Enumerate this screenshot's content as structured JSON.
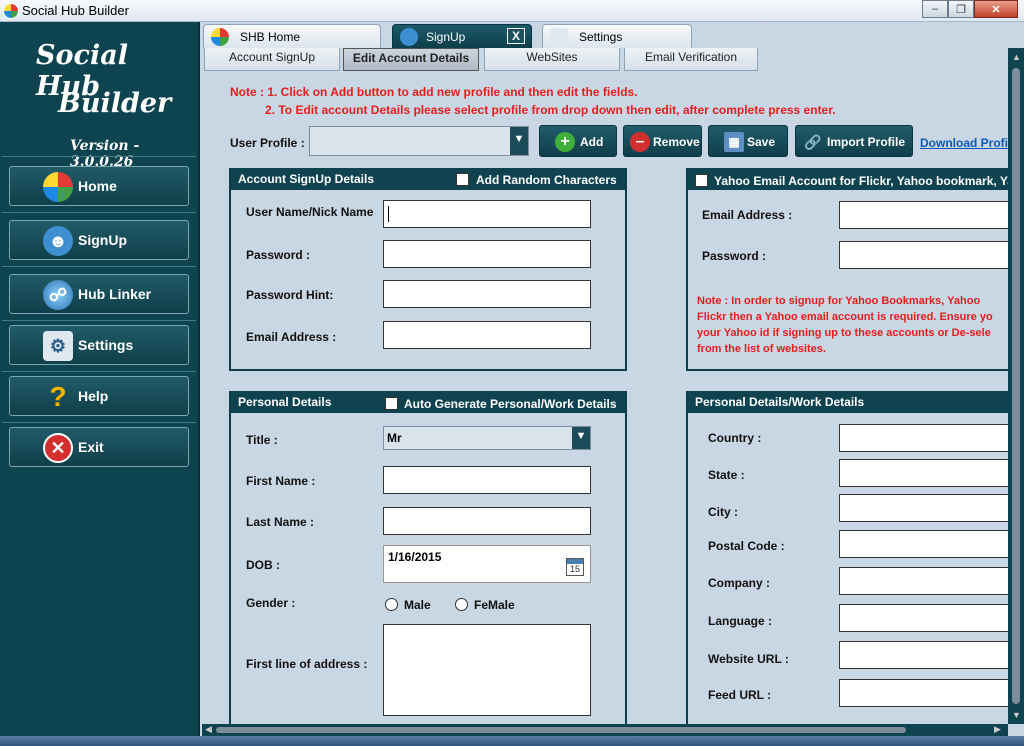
{
  "window": {
    "title": "Social Hub Builder"
  },
  "sidebar": {
    "logo_line1": "Social Hub",
    "logo_line2": "Builder",
    "version": "Version - 3.0.0.26",
    "items": [
      {
        "label": "Home",
        "icon": "home-icon"
      },
      {
        "label": "SignUp",
        "icon": "users-icon"
      },
      {
        "label": "Hub Linker",
        "icon": "globe-link-icon"
      },
      {
        "label": "Settings",
        "icon": "settings-icon"
      },
      {
        "label": "Help",
        "icon": "question-icon"
      },
      {
        "label": "Exit",
        "icon": "exit-icon"
      }
    ]
  },
  "tabs": [
    {
      "label": "SHB Home"
    },
    {
      "label": "SignUp",
      "close": "X"
    },
    {
      "label": "Settings"
    }
  ],
  "subtabs": [
    {
      "label": "Account SignUp"
    },
    {
      "label": "Edit Account Details"
    },
    {
      "label": "WebSites"
    },
    {
      "label": "Email Verification"
    }
  ],
  "notes": {
    "line1": "Note : 1. Click on Add button to add new profile and then edit the fields.",
    "line2": "2. To Edit account Details please select profile from drop down then edit, after complete press enter."
  },
  "profile": {
    "label": "User Profile :",
    "value": "",
    "buttons": {
      "add": "Add",
      "remove": "Remove",
      "save": "Save",
      "import": "Import Profile"
    },
    "download_link": "Download Profi"
  },
  "account_panel": {
    "title": "Account SignUp Details",
    "checkbox_label": "Add Random Characters",
    "fields": [
      {
        "label": "User Name/Nick Name",
        "value": ""
      },
      {
        "label": "Password :",
        "value": ""
      },
      {
        "label": "Password Hint:",
        "value": ""
      },
      {
        "label": "Email Address :",
        "value": ""
      }
    ]
  },
  "yahoo_panel": {
    "checkbox_label": "Yahoo Email Account for Flickr, Yahoo bookmark, Ya",
    "fields": [
      {
        "label": "Email Address :",
        "value": ""
      },
      {
        "label": "Password :",
        "value": ""
      }
    ],
    "note": [
      "Note :  In order to signup for Yahoo Bookmarks, Yahoo",
      "Flickr then a Yahoo email account is required. Ensure yo",
      "your Yahoo id if signing up to these accounts or De-sele",
      "from the list of websites."
    ]
  },
  "personal_panel": {
    "title": "Personal Details",
    "checkbox_label": "Auto Generate Personal/Work Details",
    "title_label": "Title :",
    "title_value": "Mr",
    "first_name_label": "First Name :",
    "last_name_label": "Last Name :",
    "dob_label": "DOB :",
    "dob_value": "1/16/2015",
    "calendar_day": "15",
    "gender_label": "Gender :",
    "gender_male": "Male",
    "gender_female": "FeMale",
    "address_label": "First line of address :"
  },
  "work_panel": {
    "title": "Personal Details/Work Details",
    "fields": [
      {
        "label": "Country :"
      },
      {
        "label": "State :"
      },
      {
        "label": "City :"
      },
      {
        "label": "Postal Code :"
      },
      {
        "label": "Company :"
      },
      {
        "label": "Language :"
      },
      {
        "label": "Website URL :"
      },
      {
        "label": "Feed URL :"
      }
    ]
  },
  "colors": {
    "sidebar": "#0e4350",
    "panel_header": "#0f4350",
    "note_red": "#e41e1e",
    "content_bg": "#c9d6e3",
    "link_blue": "#0a5bb8"
  }
}
